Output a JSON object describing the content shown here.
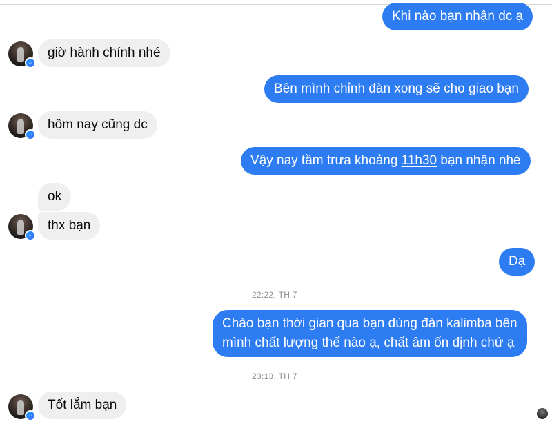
{
  "messages": {
    "m1": "Khi nào bạn nhận dc ạ",
    "m2": "giờ hành chính nhé",
    "m3": "Bên mình chỉnh đàn xong sẽ cho giao bạn",
    "m4": {
      "underlined": "hôm nay",
      "rest": " cũng dc"
    },
    "m5": {
      "before": "Vậy nay tầm trưa khoảng ",
      "underlined": "11h30",
      "after": " bạn nhận nhé"
    },
    "m6": "ok",
    "m7": "thx bạn",
    "m8": "Dạ",
    "m9": {
      "line1": "Chào bạn thời gian qua bạn dùng đàn kalimba bên",
      "line2": "mình chất lượng thế nào ạ, chất âm ổn định chứ ạ"
    },
    "m10": "Tốt lắm bạn"
  },
  "timestamps": {
    "t1": "22:22, TH 7",
    "t2": "23:13, TH 7"
  },
  "icons": {
    "avatar": "contact-avatar",
    "badge": "messenger-icon"
  },
  "colors": {
    "outgoing_bubble": "#2d7cf2",
    "incoming_bubble": "#efefef",
    "timestamp": "#8a8d91"
  }
}
